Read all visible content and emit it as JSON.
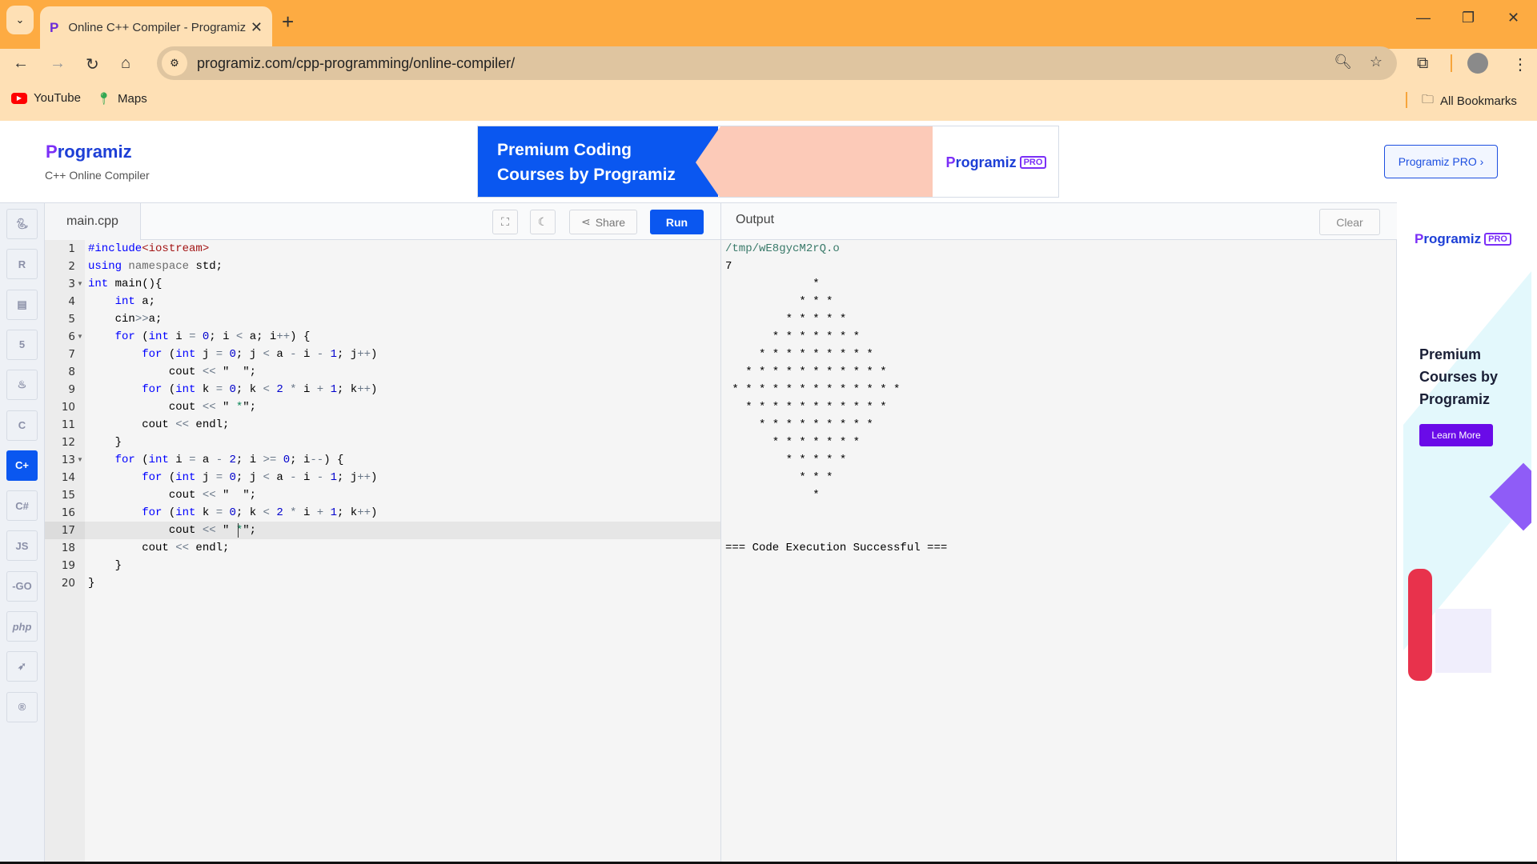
{
  "browser": {
    "tab_title": "Online C++ Compiler - Programiz",
    "url": "programiz.com/cpp-programming/online-compiler/",
    "bookmarks": [
      "YouTube",
      "Maps"
    ],
    "all_bookmarks": "All Bookmarks"
  },
  "header": {
    "logo": "Programiz",
    "subtitle": "C++ Online Compiler",
    "banner": {
      "line1": "Premium Coding",
      "line2": "Courses by Programiz",
      "brand": "Programiz",
      "pro": "PRO"
    },
    "pro_button": "Programiz PRO ›"
  },
  "sidebar": {
    "languages": [
      "python",
      "r",
      "sql",
      "html",
      "java",
      "c",
      "cpp",
      "csharp",
      "javascript",
      "go",
      "php",
      "swift",
      "rust"
    ],
    "labels": {
      "javascript": "JS",
      "go": "-GO",
      "php": "php"
    },
    "active": "cpp"
  },
  "editor": {
    "file_name": "main.cpp",
    "share_label": "Share",
    "run_label": "Run",
    "current_line": 17,
    "fold_lines": [
      3,
      6,
      13
    ],
    "lines": [
      [
        [
          "#include",
          "k"
        ],
        [
          "<iostream>",
          "r"
        ]
      ],
      [
        [
          "using",
          "k"
        ],
        [
          " ",
          ""
        ],
        [
          "namespace",
          "m"
        ],
        [
          " std;",
          ""
        ]
      ],
      [
        [
          "int",
          "k"
        ],
        [
          " main(){",
          ""
        ]
      ],
      [
        [
          "    ",
          ""
        ],
        [
          "int",
          "k"
        ],
        [
          " a;",
          ""
        ]
      ],
      [
        [
          "    cin",
          ""
        ],
        [
          ">>",
          "o"
        ],
        [
          "a;",
          ""
        ]
      ],
      [
        [
          "    ",
          ""
        ],
        [
          "for",
          "k"
        ],
        [
          " (",
          ""
        ],
        [
          "int",
          "k"
        ],
        [
          " i ",
          ""
        ],
        [
          "=",
          "o"
        ],
        [
          " ",
          ""
        ],
        [
          "0",
          "n"
        ],
        [
          "; i ",
          ""
        ],
        [
          "<",
          "o"
        ],
        [
          " a; i",
          ""
        ],
        [
          "++",
          "o"
        ],
        [
          ") {",
          ""
        ]
      ],
      [
        [
          "        ",
          ""
        ],
        [
          "for",
          "k"
        ],
        [
          " (",
          ""
        ],
        [
          "int",
          "k"
        ],
        [
          " j ",
          ""
        ],
        [
          "=",
          "o"
        ],
        [
          " ",
          ""
        ],
        [
          "0",
          "n"
        ],
        [
          "; j ",
          ""
        ],
        [
          "<",
          "o"
        ],
        [
          " a ",
          ""
        ],
        [
          "-",
          "o"
        ],
        [
          " i ",
          ""
        ],
        [
          "-",
          "o"
        ],
        [
          " ",
          ""
        ],
        [
          "1",
          "n"
        ],
        [
          "; j",
          ""
        ],
        [
          "++",
          "o"
        ],
        [
          ")",
          ""
        ]
      ],
      [
        [
          "            cout ",
          ""
        ],
        [
          "<<",
          "o"
        ],
        [
          " \"  \";",
          ""
        ]
      ],
      [
        [
          "        ",
          ""
        ],
        [
          "for",
          "k"
        ],
        [
          " (",
          ""
        ],
        [
          "int",
          "k"
        ],
        [
          " k ",
          ""
        ],
        [
          "=",
          "o"
        ],
        [
          " ",
          ""
        ],
        [
          "0",
          "n"
        ],
        [
          "; k ",
          ""
        ],
        [
          "<",
          "o"
        ],
        [
          " ",
          ""
        ],
        [
          "2",
          "n"
        ],
        [
          " ",
          ""
        ],
        [
          "*",
          "o"
        ],
        [
          " i ",
          ""
        ],
        [
          "+",
          "o"
        ],
        [
          " ",
          ""
        ],
        [
          "1",
          "n"
        ],
        [
          "; k",
          ""
        ],
        [
          "++",
          "o"
        ],
        [
          ")",
          ""
        ]
      ],
      [
        [
          "            cout ",
          ""
        ],
        [
          "<<",
          "o"
        ],
        [
          " \" ",
          ""
        ],
        [
          "*",
          "g"
        ],
        [
          "\";",
          ""
        ]
      ],
      [
        [
          "        cout ",
          ""
        ],
        [
          "<<",
          "o"
        ],
        [
          " endl;",
          ""
        ]
      ],
      [
        [
          "    }",
          ""
        ]
      ],
      [
        [
          "    ",
          ""
        ],
        [
          "for",
          "k"
        ],
        [
          " (",
          ""
        ],
        [
          "int",
          "k"
        ],
        [
          " i ",
          ""
        ],
        [
          "=",
          "o"
        ],
        [
          " a ",
          ""
        ],
        [
          "-",
          "o"
        ],
        [
          " ",
          ""
        ],
        [
          "2",
          "n"
        ],
        [
          "; i ",
          ""
        ],
        [
          ">=",
          "o"
        ],
        [
          " ",
          ""
        ],
        [
          "0",
          "n"
        ],
        [
          "; i",
          ""
        ],
        [
          "--",
          "o"
        ],
        [
          ") {",
          ""
        ]
      ],
      [
        [
          "        ",
          ""
        ],
        [
          "for",
          "k"
        ],
        [
          " (",
          ""
        ],
        [
          "int",
          "k"
        ],
        [
          " j ",
          ""
        ],
        [
          "=",
          "o"
        ],
        [
          " ",
          ""
        ],
        [
          "0",
          "n"
        ],
        [
          "; j ",
          ""
        ],
        [
          "<",
          "o"
        ],
        [
          " a ",
          ""
        ],
        [
          "-",
          "o"
        ],
        [
          " i ",
          ""
        ],
        [
          "-",
          "o"
        ],
        [
          " ",
          ""
        ],
        [
          "1",
          "n"
        ],
        [
          "; j",
          ""
        ],
        [
          "++",
          "o"
        ],
        [
          ")",
          ""
        ]
      ],
      [
        [
          "            cout ",
          ""
        ],
        [
          "<<",
          "o"
        ],
        [
          " \"  \";",
          ""
        ]
      ],
      [
        [
          "        ",
          ""
        ],
        [
          "for",
          "k"
        ],
        [
          " (",
          ""
        ],
        [
          "int",
          "k"
        ],
        [
          " k ",
          ""
        ],
        [
          "=",
          "o"
        ],
        [
          " ",
          ""
        ],
        [
          "0",
          "n"
        ],
        [
          "; k ",
          ""
        ],
        [
          "<",
          "o"
        ],
        [
          " ",
          ""
        ],
        [
          "2",
          "n"
        ],
        [
          " ",
          ""
        ],
        [
          "*",
          "o"
        ],
        [
          " i ",
          ""
        ],
        [
          "+",
          "o"
        ],
        [
          " ",
          ""
        ],
        [
          "1",
          "n"
        ],
        [
          "; k",
          ""
        ],
        [
          "++",
          "o"
        ],
        [
          ")",
          ""
        ]
      ],
      [
        [
          "            cout ",
          ""
        ],
        [
          "<<",
          "o"
        ],
        [
          " \" ",
          ""
        ],
        [
          "*",
          "g"
        ],
        [
          "\";",
          ""
        ]
      ],
      [
        [
          "        cout ",
          ""
        ],
        [
          "<<",
          "o"
        ],
        [
          " endl;",
          ""
        ]
      ],
      [
        [
          "    }",
          ""
        ]
      ],
      [
        [
          "}",
          ""
        ]
      ]
    ]
  },
  "output": {
    "title": "Output",
    "clear_label": "Clear",
    "lines": [
      "/tmp/wE8gycM2rQ.o",
      "7",
      "             *",
      "           * * *",
      "         * * * * *",
      "       * * * * * * *",
      "     * * * * * * * * *",
      "   * * * * * * * * * * *",
      " * * * * * * * * * * * * *",
      "   * * * * * * * * * * *",
      "     * * * * * * * * *",
      "       * * * * * * *",
      "         * * * * *",
      "           * * *",
      "             *",
      "",
      "",
      "=== Code Execution Successful ==="
    ]
  },
  "side_ad": {
    "brand": "Programiz",
    "pro": "PRO",
    "headline": "Premium Courses by Programiz",
    "cta": "Learn More"
  },
  "colors": {
    "accent": "#0a57f0",
    "tabstrip": "#fdab42",
    "toolbar": "#fee0b5",
    "cta": "#6a0be8"
  }
}
